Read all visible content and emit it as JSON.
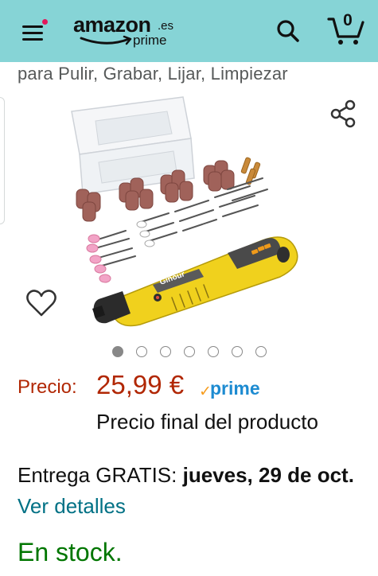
{
  "header": {
    "logo_word": "amazon",
    "logo_tld": ".es",
    "logo_sub": "prime",
    "cart_count": "0",
    "icons": {
      "menu": "hamburger-menu-icon",
      "notification": "notification-dot-icon",
      "search": "search-icon",
      "cart": "cart-icon"
    },
    "colors": {
      "background": "#86d4d6",
      "notification_dot": "#e3175a"
    }
  },
  "product": {
    "title_fragment": "para Pulir, Grabar, Lijar, Limpiezar",
    "image": {
      "description_icon": "rotary-tool-kit-image",
      "brand_text": "Ginour"
    },
    "carousel": {
      "total": 7,
      "active_index": 0
    },
    "icons": {
      "share": "share-icon",
      "wishlist": "heart-outline-icon"
    }
  },
  "pricing": {
    "label": "Precio:",
    "value": "25,99 €",
    "prime_check": "✓",
    "prime_text": "prime",
    "final_note": "Precio final del producto",
    "colors": {
      "price": "#b12704",
      "prime": "#1d8bd1",
      "prime_check": "#f79c1d"
    }
  },
  "delivery": {
    "prefix": "Entrega GRATIS: ",
    "date": "jueves, 29 de oct.",
    "link": "Ver detalles",
    "colors": {
      "link": "#007185"
    }
  },
  "availability": {
    "text": "En stock.",
    "color": "#007600"
  }
}
